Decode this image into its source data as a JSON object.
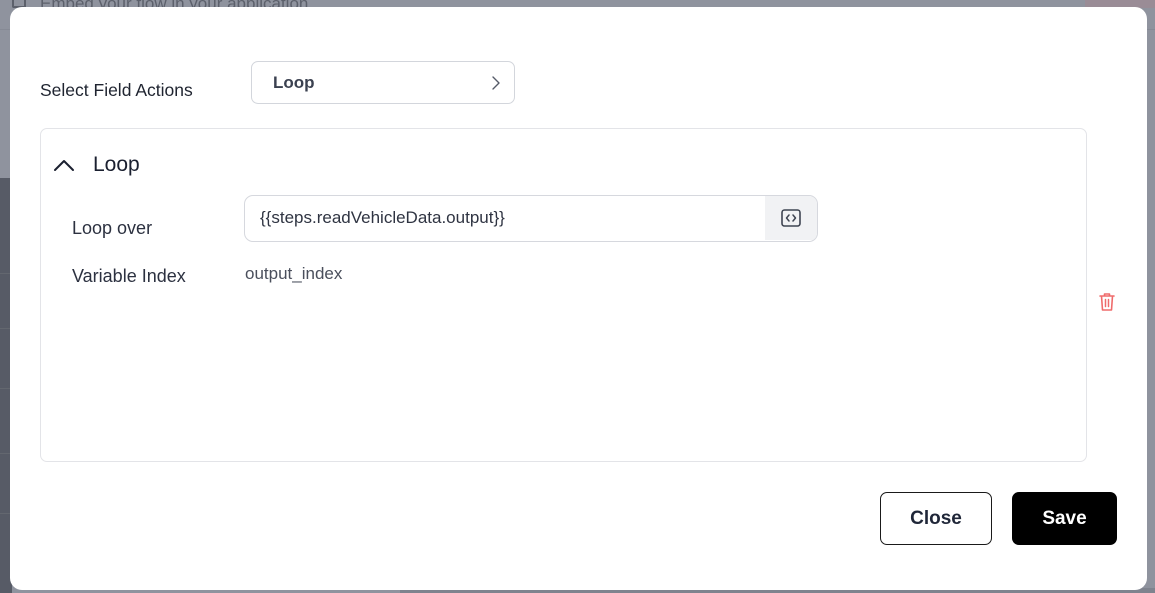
{
  "background": {
    "top_bar_text": "Embed your flow in your application"
  },
  "modal": {
    "select_field_actions": {
      "label": "Select Field Actions",
      "value": "Loop"
    },
    "loop_panel": {
      "title": "Loop",
      "expanded": true,
      "loop_over": {
        "label": "Loop over",
        "value": "{{steps.readVehicleData.output}}"
      },
      "variable_index": {
        "label": "Variable Index",
        "value": "output_index"
      }
    },
    "buttons": {
      "close_label": "Close",
      "save_label": "Save"
    },
    "colors": {
      "primary": "#000000",
      "danger": "#ef6b6b",
      "overlay": "#8f939e"
    }
  }
}
